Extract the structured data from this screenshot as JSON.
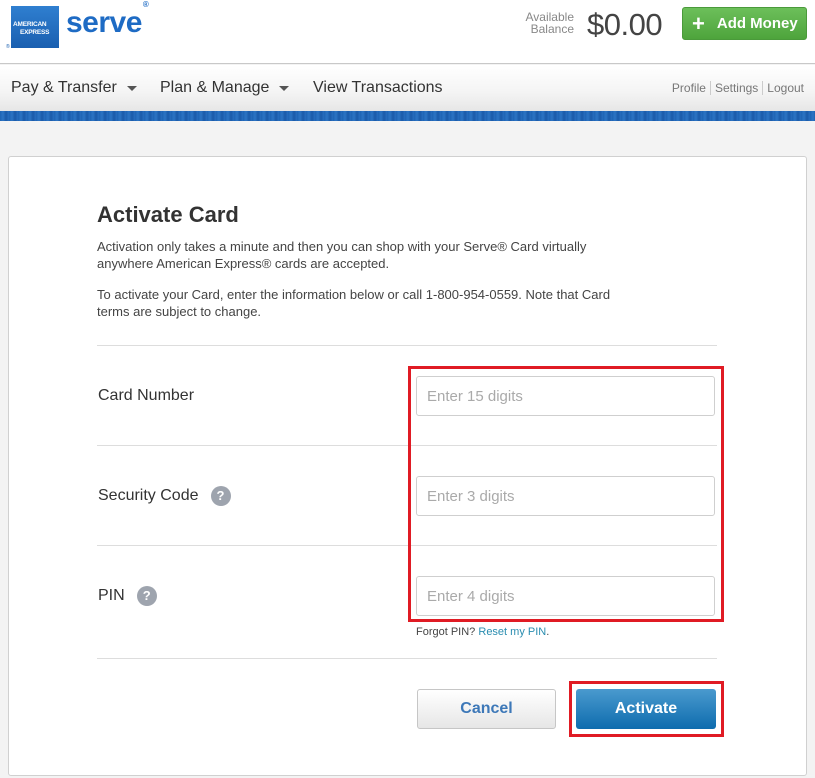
{
  "header": {
    "logo": {
      "amex_line1": "AMERICAN",
      "amex_line2": "EXPRESS",
      "registered": "®",
      "brand": "serve",
      "brand_mark": "®"
    },
    "balance_label_line1": "Available",
    "balance_label_line2": "Balance",
    "balance_value": "$0.00",
    "add_money": {
      "icon": "plus-icon",
      "glyph": "+",
      "label": "Add Money"
    }
  },
  "nav": {
    "items": [
      {
        "label": "Pay & Transfer",
        "dropdown": true
      },
      {
        "label": "Plan & Manage",
        "dropdown": true
      },
      {
        "label": "View Transactions",
        "dropdown": false
      }
    ],
    "utility_links": [
      "Profile",
      "Settings",
      "Logout"
    ]
  },
  "form": {
    "title": "Activate Card",
    "intro_para1": "Activation only takes a minute and then you can shop with your Serve® Card virtually anywhere American Express® cards are accepted.",
    "intro_para2": "To activate your Card, enter the information below or call 1-800-954-0559. Note that Card terms are subject to change.",
    "fields": [
      {
        "label": "Card Number",
        "placeholder": "Enter 15 digits",
        "value": "",
        "help": false
      },
      {
        "label": "Security Code",
        "placeholder": "Enter 3 digits",
        "value": "",
        "help": true
      },
      {
        "label": "PIN",
        "placeholder": "Enter 4 digits",
        "value": "",
        "help": true
      }
    ],
    "help_glyph": "?",
    "forgot_text": "Forgot PIN?",
    "reset_link": "Reset my PIN",
    "reset_suffix": ".",
    "cancel_label": "Cancel",
    "activate_label": "Activate"
  },
  "colors": {
    "brand_blue": "#1e6bc4",
    "add_money_green": "#5bb04a",
    "activate_blue": "#0e6cae",
    "link_teal": "#2a8db0",
    "highlight_red": "#e01b24"
  }
}
